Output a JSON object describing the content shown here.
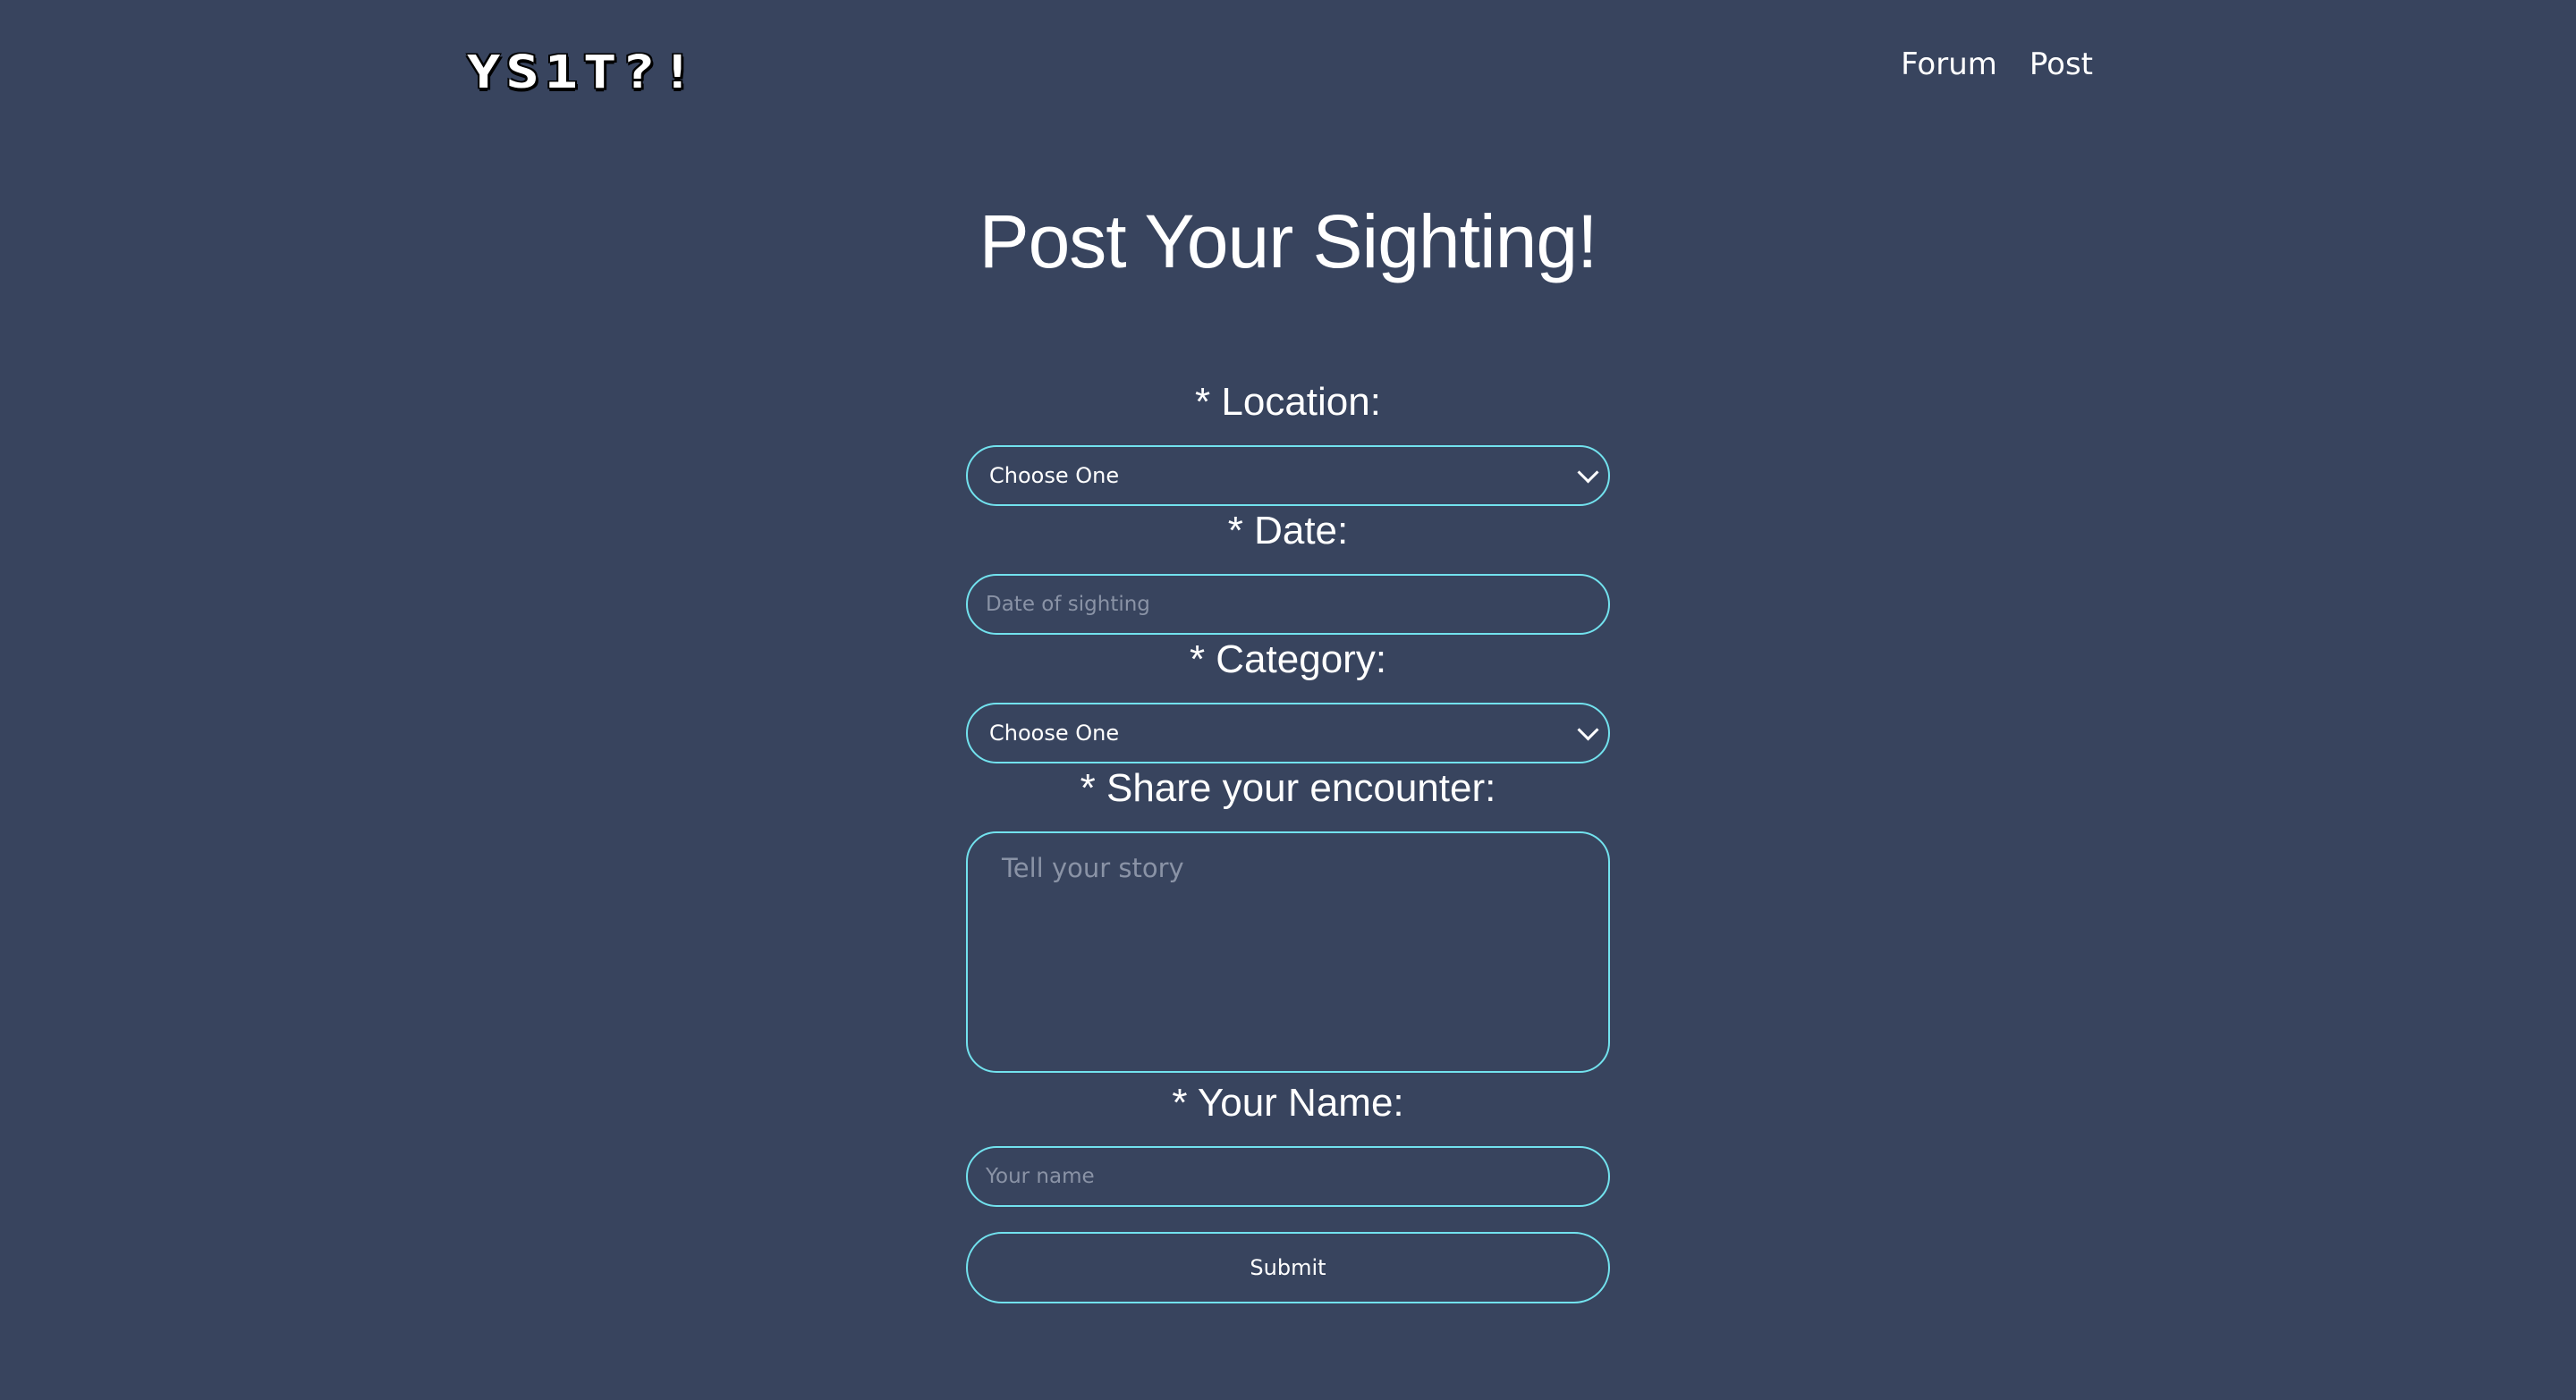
{
  "header": {
    "logo_text": "YS1T?!",
    "nav": [
      {
        "label": "Forum"
      },
      {
        "label": "Post"
      }
    ]
  },
  "main": {
    "title": "Post Your Sighting!"
  },
  "form": {
    "location": {
      "label": "* Location:",
      "selected": "Choose One"
    },
    "date": {
      "label": "* Date:",
      "placeholder": "Date of sighting"
    },
    "category": {
      "label": "* Category:",
      "selected": "Choose One"
    },
    "encounter": {
      "label": "* Share your encounter:",
      "placeholder": "Tell your story"
    },
    "name": {
      "label": "* Your Name:",
      "placeholder": "Your name"
    },
    "submit_label": "Submit"
  },
  "colors": {
    "background": "#38445e",
    "accent_border": "#72e2ee",
    "text": "#ffffff",
    "placeholder": "#8a93a6"
  },
  "icons": {
    "select_arrow": "chevron-down-icon"
  }
}
